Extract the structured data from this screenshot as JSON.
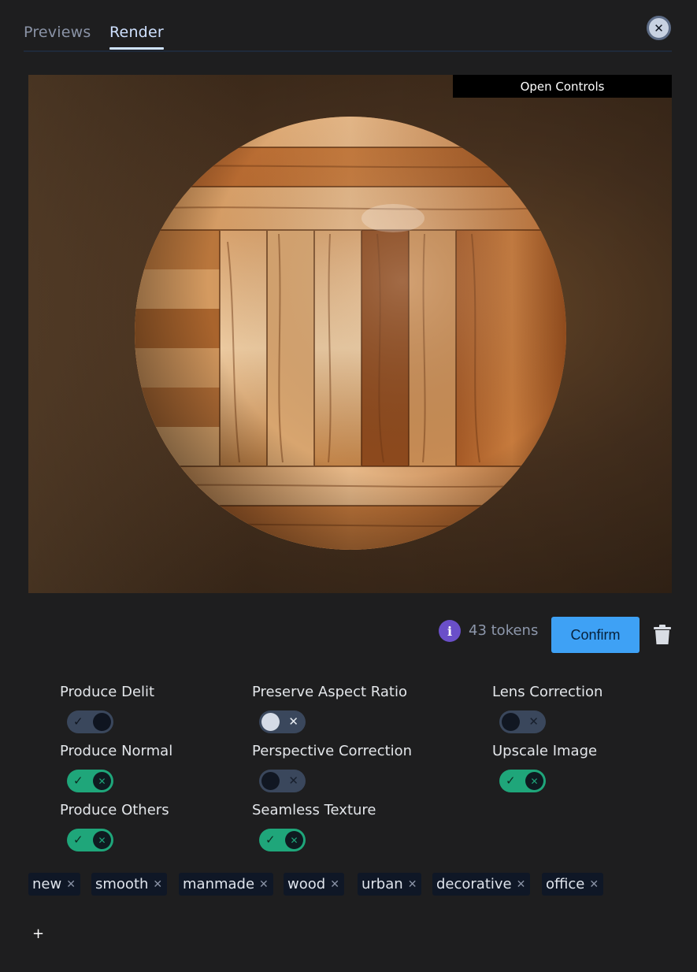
{
  "tabs": [
    {
      "label": "Previews",
      "active": false
    },
    {
      "label": "Render",
      "active": true
    }
  ],
  "close_icon": "close-icon",
  "preview": {
    "open_controls_label": "Open Controls"
  },
  "actions": {
    "info_icon": "info-icon",
    "info_glyph": "i",
    "tokens": "43 tokens",
    "confirm_label": "Confirm",
    "delete_icon": "trash-icon"
  },
  "options": [
    {
      "label": "Produce Delit",
      "on": false
    },
    {
      "label": "Preserve Aspect Ratio",
      "on": false
    },
    {
      "label": "Lens Correction",
      "on": false
    },
    {
      "label": "Produce Normal",
      "on": true
    },
    {
      "label": "Perspective Correction",
      "on": false
    },
    {
      "label": "Upscale Image",
      "on": true
    },
    {
      "label": "Produce Others",
      "on": true
    },
    {
      "label": "Seamless Texture",
      "on": true
    }
  ],
  "tags": [
    "new",
    "smooth",
    "manmade",
    "wood",
    "urban",
    "decorative",
    "office"
  ],
  "add_tag_label": "+",
  "colors": {
    "background": "#1e1e1f",
    "accent_blue": "#3ea1f5",
    "toggle_on": "#1fa67a",
    "toggle_off": "#3a475c",
    "info_purple": "#6a4fc9"
  }
}
